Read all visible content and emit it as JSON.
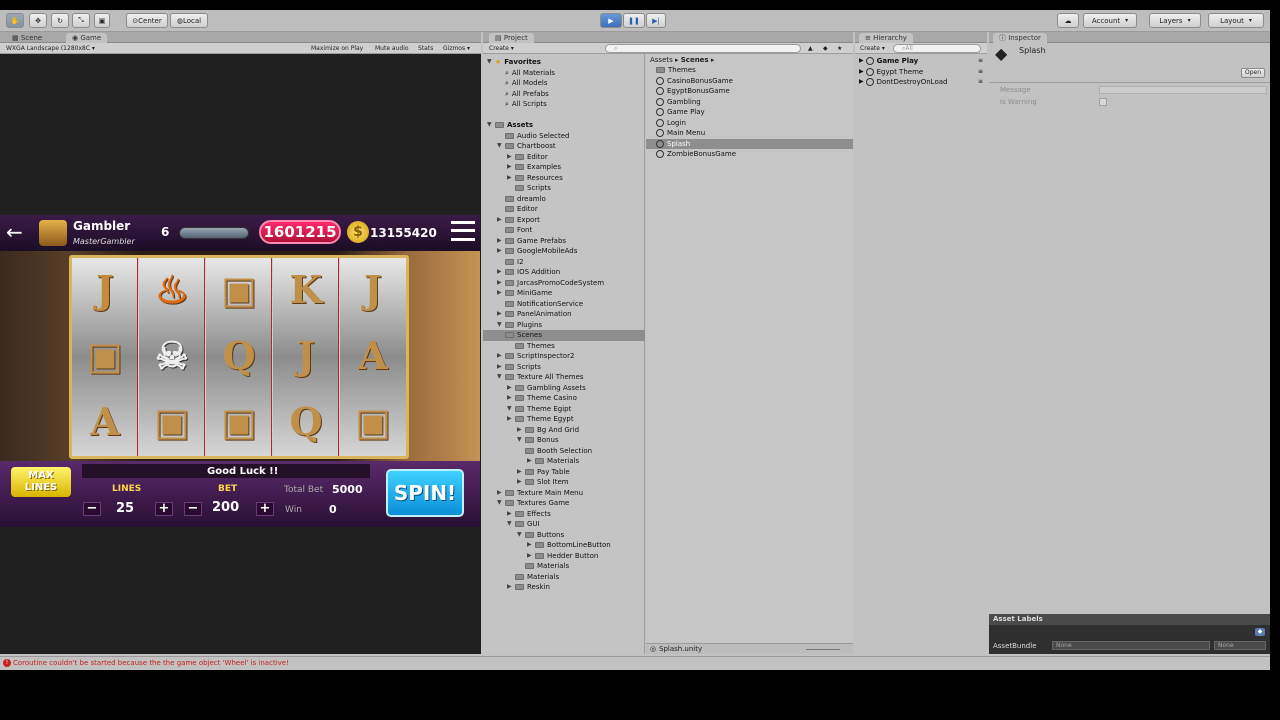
{
  "toolbar": {
    "pivot": "Center",
    "space": "Local",
    "account": "Account",
    "layers": "Layers",
    "layout": "Layout"
  },
  "scene_tab": "Scene",
  "game_tab": "Game",
  "game": {
    "resolution": "WXGA Landscape (1280x8C",
    "maximize": "Maximize on Play",
    "mute": "Mute audio",
    "stats": "Stats",
    "gizmos": "Gizmos"
  },
  "slot": {
    "title": "Gambler",
    "subtitle": "MasterGambler",
    "level": "6",
    "score": "1601215",
    "coins": "13155420",
    "max_lines": "MAX LINES",
    "lines_label": "LINES",
    "lines": "25",
    "bet_label": "BET",
    "bet": "200",
    "good_luck": "Good Luck !!",
    "total_bet_label": "Total Bet",
    "total_bet": "5000",
    "win_label": "Win",
    "win": "0",
    "spin": "SPIN!"
  },
  "project": {
    "tab": "Project",
    "create": "Create",
    "favorites": [
      "Favorites",
      "All Materials",
      "All Models",
      "All Prefabs",
      "All Scripts"
    ],
    "assets_root": "Assets",
    "tree": [
      "Audio Selected",
      "Chartboost",
      "Editor",
      "Examples",
      "Resources",
      "Scripts",
      "dreamlo",
      "Editor",
      "Export",
      "Font",
      "Game Prefabs",
      "GoogleMobileAds",
      "I2",
      "IOS Addition",
      "JarcasPromoCodeSystem",
      "MiniGame",
      "NotificationService",
      "PanelAnimation",
      "Plugins",
      "Scenes",
      "Themes",
      "ScriptInspector2",
      "Scripts",
      "Texture All Themes",
      "Gambling Assets",
      "Theme Casino",
      "Theme Egipt",
      "Theme Egypt",
      "Bg And Grid",
      "Bonus",
      "Booth Selection",
      "Materials",
      "Pay Table",
      "Slot Item",
      "Texture Main Menu",
      "Textures Game",
      "Effects",
      "GUI",
      "Buttons",
      "BottomLineButton",
      "Hedder Button",
      "Materials",
      "Materials",
      "Reskin"
    ],
    "breadcrumb_root": "Assets",
    "breadcrumb_leaf": "Scenes",
    "files": [
      "Themes",
      "CasinoBonusGame",
      "EgyptBonusGame",
      "Gambling",
      "Game Play",
      "Login",
      "Main Menu",
      "Splash",
      "ZombieBonusGame"
    ],
    "footer": "Splash.unity"
  },
  "hierarchy": {
    "tab": "Hierarchy",
    "create": "Create",
    "search": "All",
    "items": [
      "Game Play",
      "Egypt Theme",
      "DontDestroyOnLoad"
    ]
  },
  "inspector": {
    "tab": "Inspector",
    "name": "Splash",
    "open": "Open",
    "fields": [
      "Message",
      "Is Warning"
    ],
    "asset_labels": "Asset Labels",
    "asset_bundle": "AssetBundle",
    "none1": "None",
    "none2": "None"
  },
  "console": "Coroutine couldn't be started because the the game object 'Wheel' is inactive!"
}
